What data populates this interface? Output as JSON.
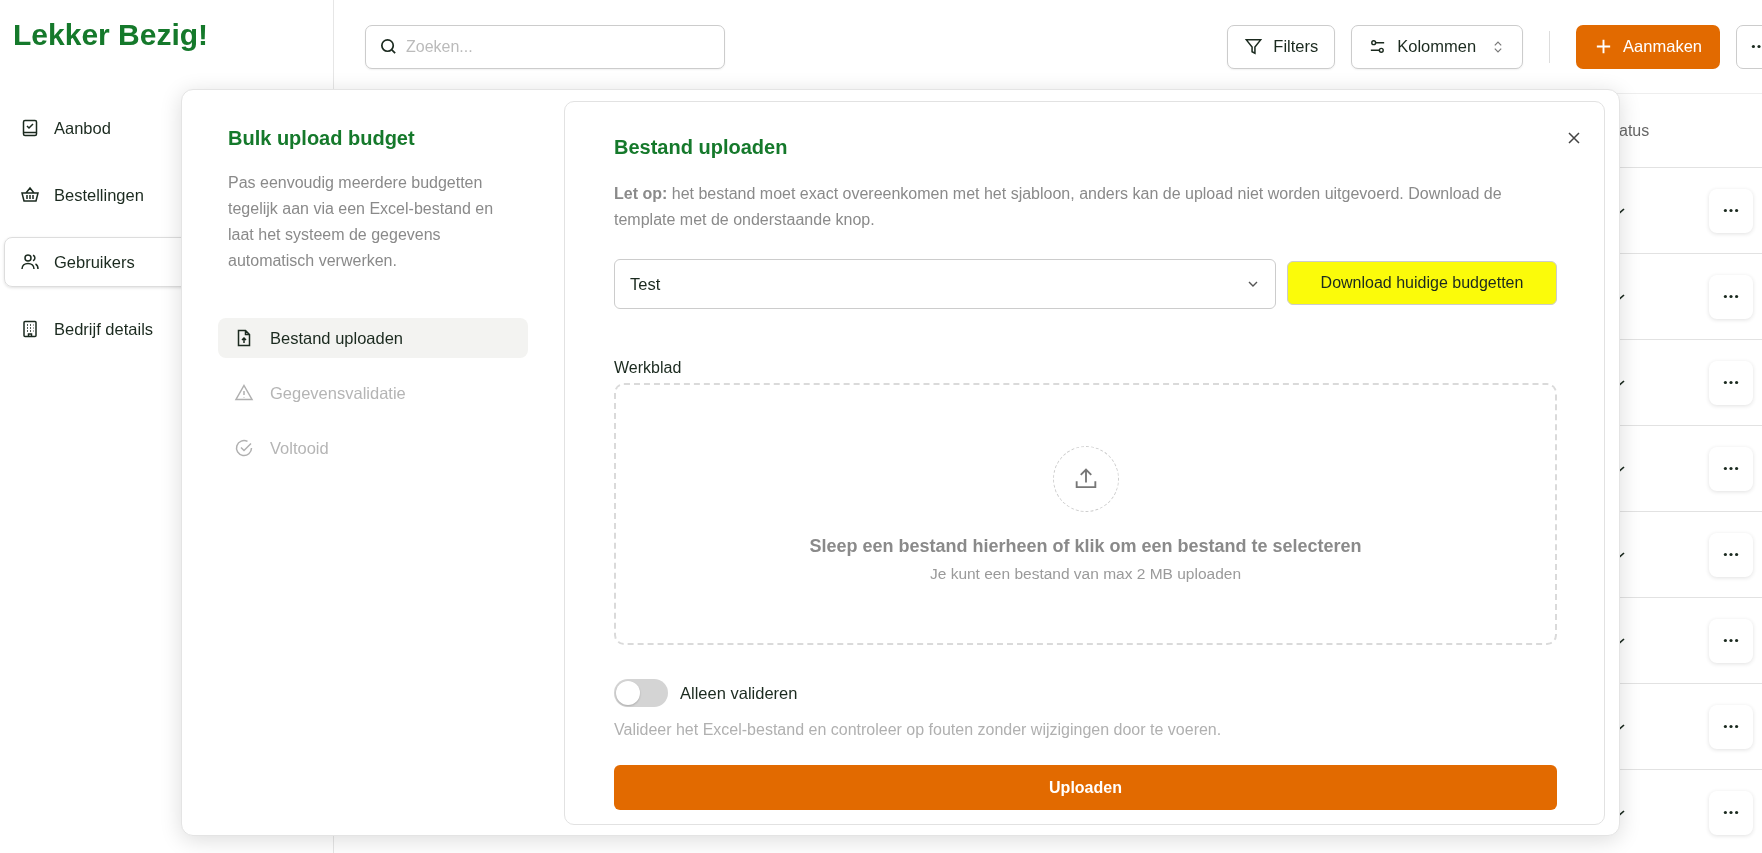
{
  "brand": "Lekker Bezig!",
  "sidebar": {
    "items": [
      {
        "label": "Aanbod",
        "selected": false
      },
      {
        "label": "Bestellingen",
        "selected": false
      },
      {
        "label": "Gebruikers",
        "selected": true
      },
      {
        "label": "Bedrijf details",
        "selected": false
      }
    ]
  },
  "search": {
    "placeholder": "Zoeken..."
  },
  "toolbar": {
    "filters_button": "Filters",
    "columns_button": "Kolommen",
    "create_button": "Aanmaken"
  },
  "table": {
    "column_header": "atus",
    "rows": [
      {
        "checked": true
      },
      {
        "checked": true
      },
      {
        "checked": true
      },
      {
        "checked": true
      },
      {
        "checked": true
      },
      {
        "checked": true
      },
      {
        "checked": true
      },
      {
        "checked": true
      }
    ]
  },
  "modal": {
    "title": "Bulk upload budget",
    "description": "Pas eenvoudig meerdere budgetten tegelijk aan via een Excel-bestand en laat het systeem de gegevens automatisch verwerken.",
    "steps": [
      {
        "label": "Bestand uploaden",
        "selected": true
      },
      {
        "label": "Gegevensvalidatie",
        "selected": false
      },
      {
        "label": "Voltooid",
        "selected": false
      }
    ],
    "panel": {
      "title": "Bestand uploaden",
      "note": "**Let op:** het bestand moet exact overeenkomen met het sjabloon, anders kan de upload niet worden uitgevoerd. Download de template met de onderstaande knop.",
      "select": {
        "value": "Test"
      },
      "download_button": {
        "label": "Download huidige budgetten",
        "highlighted": true
      },
      "dropzone": {
        "label": "Werkblad",
        "text": "Sleep een bestand hierheen of klik om een bestand te selecteren",
        "hint": "Je kunt een bestand van max 2 MB uploaden"
      },
      "toggle": {
        "label": "Alleen valideren",
        "on": false,
        "hint": "Valideer het Excel-bestand en controleer op fouten zonder wijzigingen door te voeren."
      },
      "submit_button": "Uploaden"
    }
  }
}
